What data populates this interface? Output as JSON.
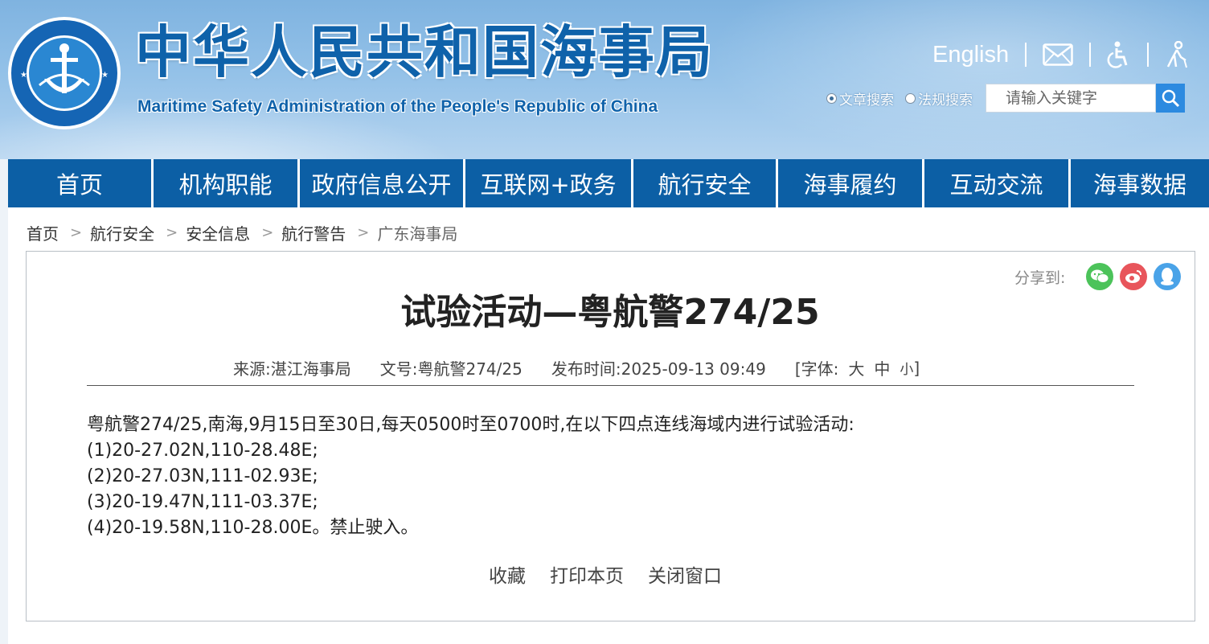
{
  "header": {
    "site_title": "中华人民共和国海事局",
    "site_subtitle": "Maritime Safety Administration of the People's Republic of China",
    "emblem_top_text": "中国海事局",
    "emblem_bottom_text": "CHINA MSA",
    "english_link": "English",
    "search": {
      "option_articles": "文章搜索",
      "option_regulations": "法规搜索",
      "selected": "文章搜索",
      "placeholder": "请输入关键字"
    }
  },
  "nav": {
    "items": [
      "首页",
      "机构职能",
      "政府信息公开",
      "互联网+政务",
      "航行安全",
      "海事履约",
      "互动交流",
      "海事数据"
    ]
  },
  "breadcrumb": {
    "items": [
      "首页",
      "航行安全",
      "安全信息",
      "航行警告",
      "广东海事局"
    ],
    "separator": ">"
  },
  "share": {
    "label": "分享到:",
    "icons": [
      "wechat-icon",
      "weibo-icon",
      "qq-icon"
    ],
    "colors": {
      "wechat": "#4cc35a",
      "weibo": "#e8555b",
      "qq": "#4aa3e8"
    }
  },
  "article": {
    "title": "试验活动—粤航警274/25",
    "meta": {
      "source": "来源:湛江海事局",
      "doc_no": "文号:粤航警274/25",
      "publish_time": "发布时间:2025-09-13 09:49",
      "font_label": "[字体:",
      "font_large": "大",
      "font_medium": "中",
      "font_small": "小",
      "font_end": "]"
    },
    "body": [
      "粤航警274/25,南海,9月15日至30日,每天0500时至0700时,在以下四点连线海域内进行试验活动:",
      "(1)20-27.02N,110-28.48E;",
      "(2)20-27.03N,111-02.93E;",
      "(3)20-19.47N,111-03.37E;",
      "(4)20-19.58N,110-28.00E。禁止驶入。"
    ]
  },
  "actions": {
    "favorite": "收藏",
    "print": "打印本页",
    "close": "关闭窗口"
  },
  "colors": {
    "nav_bg": "#0c5fa5",
    "brand_blue": "#0f62aa",
    "search_button": "#2c8ae0"
  }
}
